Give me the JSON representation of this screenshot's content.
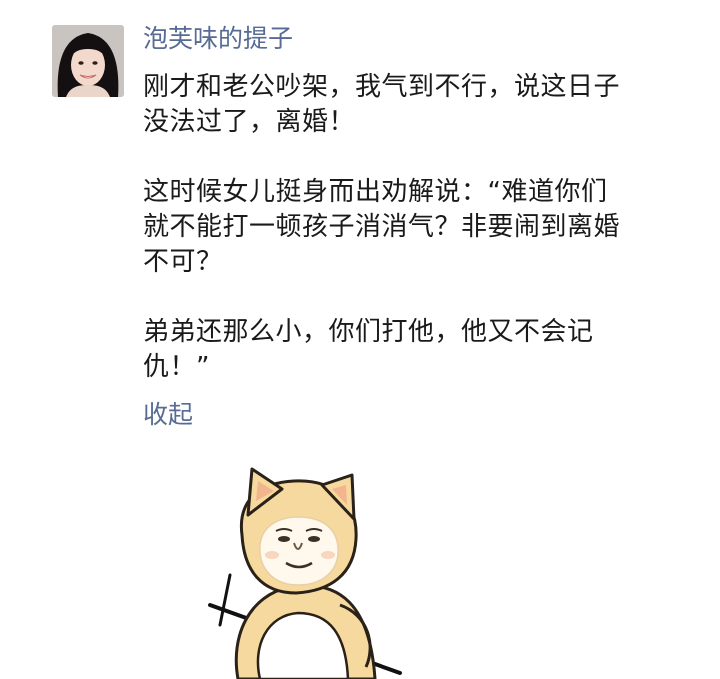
{
  "post": {
    "username": "泡芙味的提子",
    "paragraphs": [
      "刚才和老公吵架，我气到不行，说这日子\n没法过了，离婚！",
      "这时候女儿挺身而出劝解说：“难道你们\n就不能打一顿孩子消消气？非要闹到离婚\n不可？",
      "弟弟还那么小，你们打他，他又不会记\n仇！”"
    ],
    "collapse_label": "收起",
    "accent_color": "#576b95",
    "image_icon": "shiba-doge-meme-sticker"
  }
}
